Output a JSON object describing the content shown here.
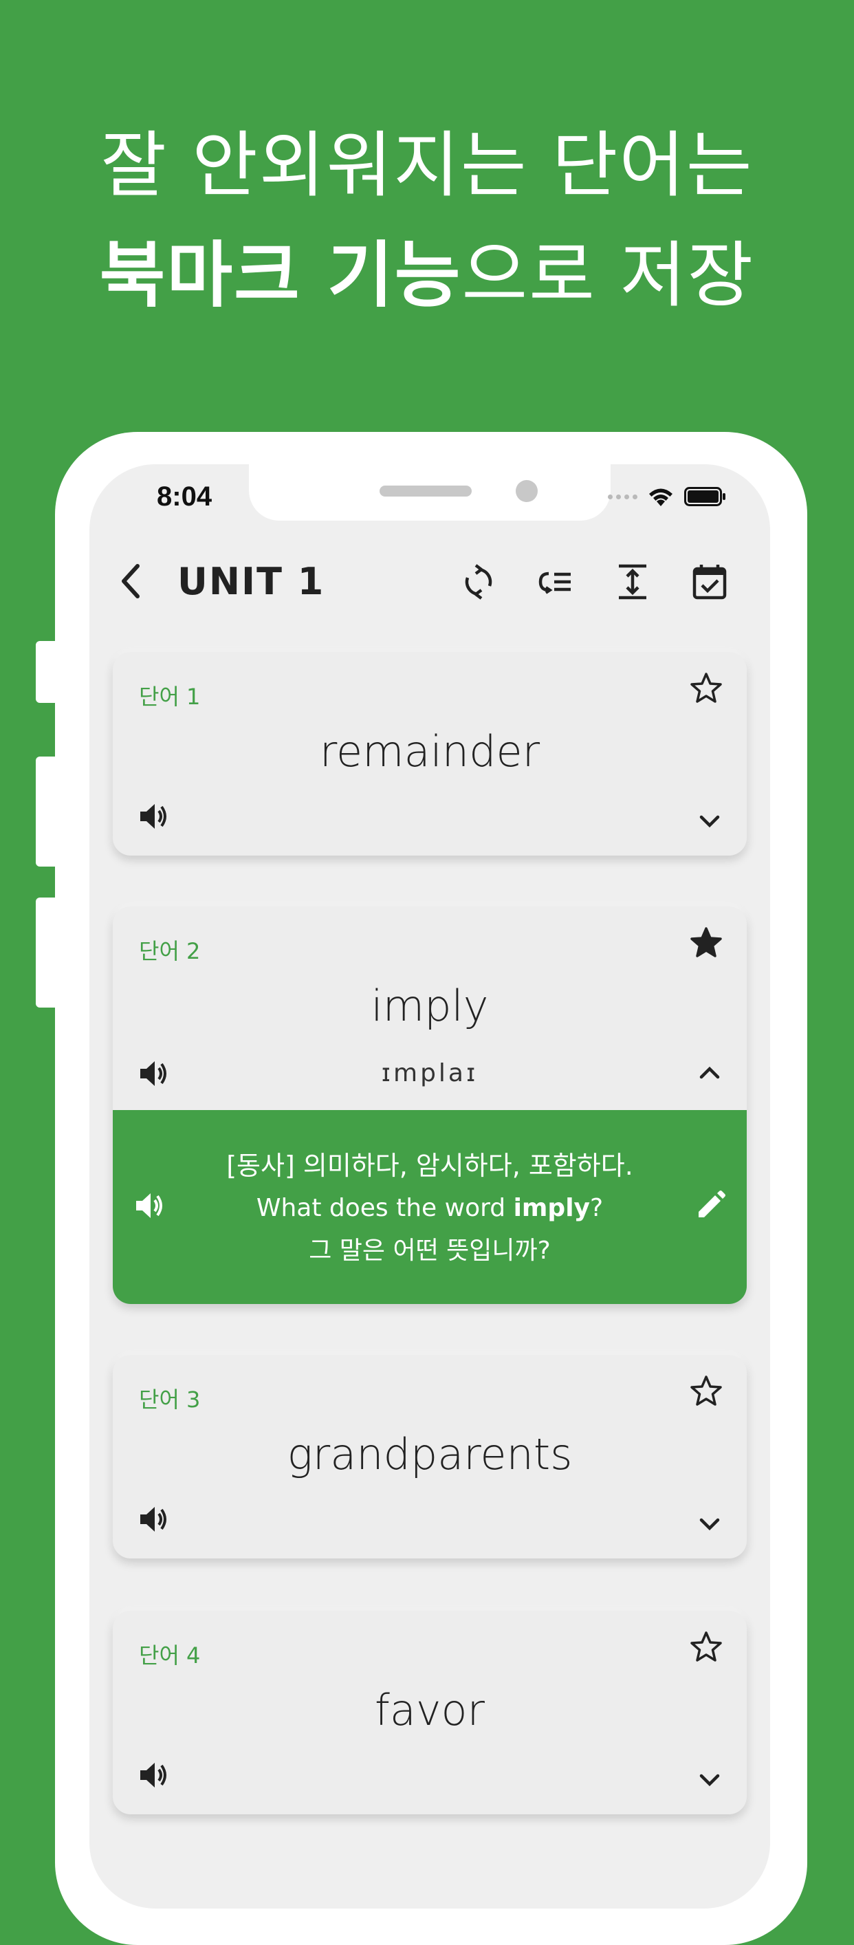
{
  "headline": {
    "line1": "잘 안외워지는 단어는",
    "line2_bold": "북마크 기능",
    "line2_rest": "으로 저장"
  },
  "status": {
    "time": "8:04"
  },
  "nav": {
    "title": "UNIT 1",
    "icons": [
      "back-icon",
      "refresh-icon",
      "sort-list-icon",
      "expand-vertical-icon",
      "calendar-check-icon"
    ]
  },
  "cards": [
    {
      "label": "단어 1",
      "word": "remainder",
      "bookmarked": false,
      "expanded": false
    },
    {
      "label": "단어 2",
      "word": "imply",
      "phonetic": "ɪmplaɪ",
      "bookmarked": true,
      "expanded": true,
      "meaning": "[동사] 의미하다, 암시하다, 포함하다.",
      "example_pre": "What does the word ",
      "example_bold": "imply",
      "example_post": "?",
      "translation": "그 말은 어떤 뜻입니까?"
    },
    {
      "label": "단어 3",
      "word": "grandparents",
      "bookmarked": false,
      "expanded": false
    },
    {
      "label": "단어 4",
      "word": "favor",
      "bookmarked": false,
      "expanded": false
    }
  ],
  "colors": {
    "brand_green": "#43a047",
    "card_bg": "#ededed",
    "screen_bg": "#efefef"
  }
}
